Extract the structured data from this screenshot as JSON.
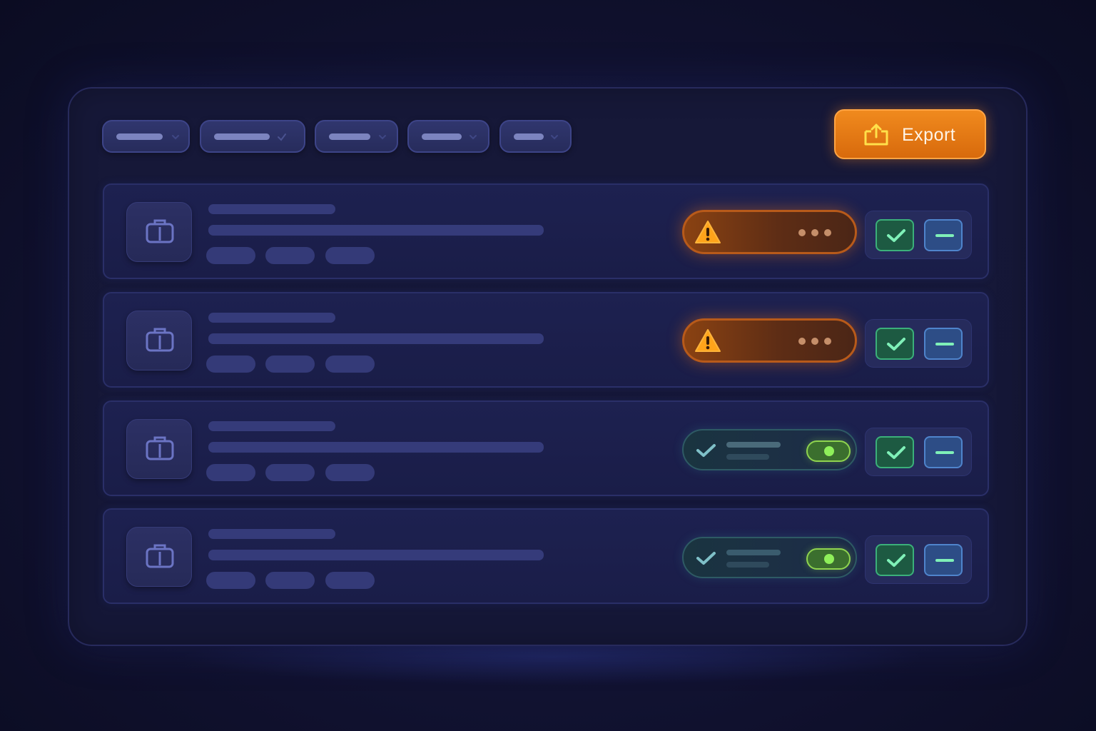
{
  "toolbar": {
    "filters": [
      {
        "name": "filter-1",
        "icon": "chevron-down-icon"
      },
      {
        "name": "filter-2",
        "icon": "check-icon"
      },
      {
        "name": "filter-3",
        "icon": "chevron-down-icon"
      },
      {
        "name": "filter-4",
        "icon": "chevron-down-icon"
      },
      {
        "name": "filter-5",
        "icon": "chevron-down-icon"
      }
    ],
    "export_label": "Export",
    "export_icon": "export-tray-icon"
  },
  "rows": [
    {
      "status": "warning",
      "status_icon": "warning-icon",
      "item_icon": "briefcase-icon"
    },
    {
      "status": "warning",
      "status_icon": "warning-icon",
      "item_icon": "briefcase-icon"
    },
    {
      "status": "ok",
      "status_icon": "check-icon",
      "toggle_on": true,
      "item_icon": "briefcase-icon"
    },
    {
      "status": "ok",
      "status_icon": "check-icon",
      "toggle_on": true,
      "item_icon": "briefcase-icon"
    }
  ],
  "colors": {
    "accent_orange": "#f08a1e",
    "approve_green": "#3bb07a",
    "reject_blue": "#4f84cc",
    "toggle_green": "#8ff05a",
    "background": "#121333"
  }
}
